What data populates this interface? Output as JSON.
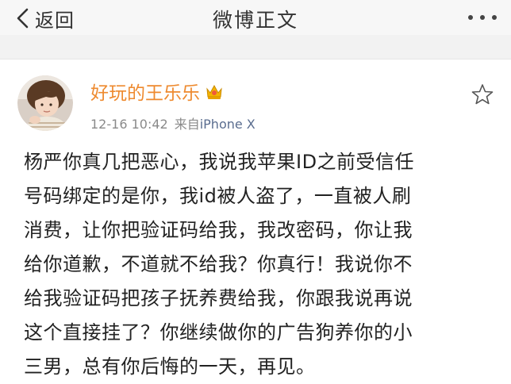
{
  "header": {
    "back_label": "返回",
    "title": "微博正文"
  },
  "post": {
    "author": "好玩的王乐乐",
    "timestamp": "12-16 10:42",
    "source_prefix": "来自",
    "source": "iPhone X",
    "body_lines": [
      "杨严你真几把恶心，我说我苹果ID之前受信任",
      "号码绑定的是你，我id被人盗了，一直被人刷",
      "消费，让你把验证码给我，我改密码，你让我",
      "给你道歉，不道就不给我？你真行！我说你不",
      "给我验证码把孩子抚养费给我，你跟我说再说",
      "这个直接挂了？你继续做你的广告狗养你的小",
      "三男，总有你后悔的一天，再见。"
    ]
  },
  "icons": {
    "back": "chevron-left-icon",
    "more": "more-dots-icon",
    "verified": "crown-badge-icon",
    "favorite": "star-outline-icon"
  },
  "colors": {
    "author": "#ee8a2f",
    "source_link": "#5a6d8f",
    "meta_gray": "#8a8a8a",
    "header_bg": "#f7f7f7",
    "separator_bg": "#f2f2f2"
  }
}
